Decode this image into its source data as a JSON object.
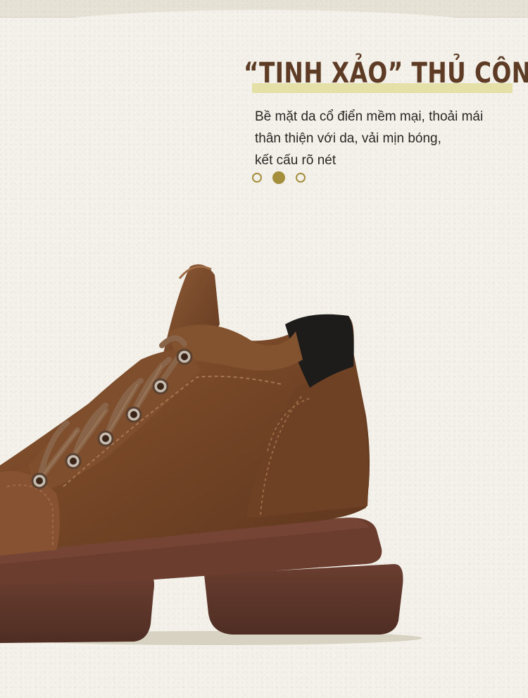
{
  "headline": "“TINH XẢO” THỦ CÔNG",
  "description": {
    "lines": [
      "Bề mặt da cổ điển mềm mại, thoải mái",
      "thân thiện với da, vải mịn bóng,",
      "kết cấu rõ nét"
    ]
  },
  "carousel": {
    "count": 3,
    "active_index": 1
  },
  "colors": {
    "background": "#f3f1ea",
    "headline": "#5e3b24",
    "headline_highlight": "#e5e0a7",
    "dot_accent": "#a68f3c",
    "leather": "#7a4a2a",
    "sole": "#5a3428",
    "heel_collar": "#1e1c1b"
  },
  "product_image": {
    "icon": "brown-leather-boot-image"
  }
}
